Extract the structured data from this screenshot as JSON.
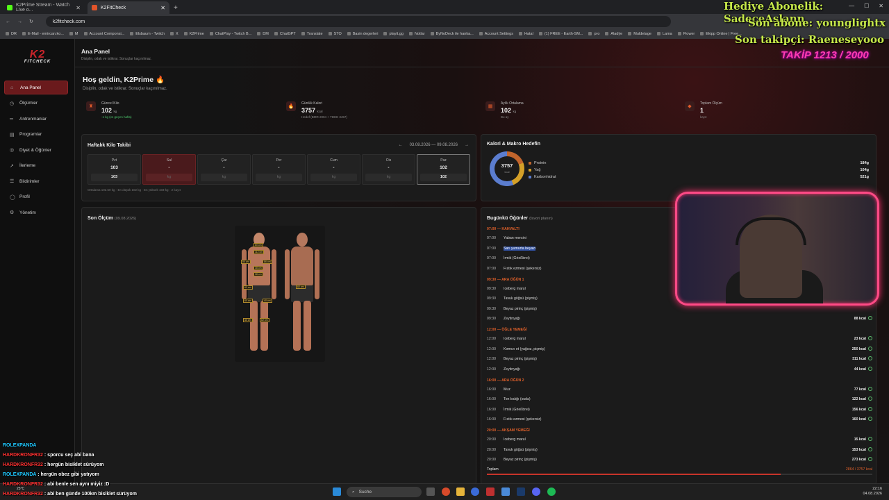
{
  "browser": {
    "tabs": [
      {
        "label": "K2Prime Stream - Watch Live o...",
        "active": false
      },
      {
        "label": "K2FitCheck",
        "active": true
      }
    ],
    "new_tab": "+",
    "url": "k2fitcheck.com",
    "bookmarks": [
      "DR",
      "E-Mail - emircan.ko...",
      "M",
      "Account Componsi...",
      "Elsbaum - Twitch",
      "X",
      "K2Prime",
      "ChatPlay - Twitch B...",
      "DM",
      "ChatGPT",
      "Translate",
      "STO",
      "Basin degerleri",
      "playit.gg",
      "Notlar",
      "ByNoDeck ile hanka...",
      "Account Settings",
      "Hatal",
      "(1) FREE - Earth-SM...",
      "pro",
      "Aladýe",
      "Muldetage",
      "Lama",
      "Flower",
      "Ekipp Online | Free..."
    ]
  },
  "sidebar": {
    "logo": "K2",
    "logo_sub": "FITCHECK",
    "items": [
      {
        "icon": "⌂",
        "label": "Ana Panel",
        "active": true
      },
      {
        "icon": "◷",
        "label": "Ölçümler"
      },
      {
        "icon": "═",
        "label": "Antrenmanlar"
      },
      {
        "icon": "▤",
        "label": "Programlar"
      },
      {
        "icon": "◎",
        "label": "Diyet & Öğünler"
      },
      {
        "icon": "↗",
        "label": "İlerleme"
      },
      {
        "icon": "☰",
        "label": "Bildirimler"
      },
      {
        "icon": "◯",
        "label": "Profil"
      },
      {
        "icon": "⚙",
        "label": "Yönetim"
      }
    ]
  },
  "header": {
    "title": "Ana Panel",
    "subtitle": "Disiplin, odak ve istikrar. Sonuçlar kaçınılmaz."
  },
  "welcome": {
    "title": "Hoş geldin, K2Prime 🔥",
    "subtitle": "Disiplin, odak ve istikrar. Sonuçlar kaçınılmaz."
  },
  "stats": [
    {
      "icon": "♜",
      "label": "Güncel Kilo",
      "value": "102",
      "unit": "kg",
      "note": "-1 kg (vs geçen hafta)",
      "positive": true
    },
    {
      "icon": "🔥",
      "label": "Günlük Kalori",
      "value": "3757",
      "unit": "kcal",
      "note": "Hedef (BMR 2004 + TDEE 3457)"
    },
    {
      "icon": "▦",
      "label": "Aylık Ortalama",
      "value": "102",
      "unit": "kg",
      "note": "Bu ay"
    },
    {
      "icon": "◆",
      "label": "Toplam Ölçüm",
      "value": "1",
      "unit": "",
      "note": "kayıt"
    }
  ],
  "weekly": {
    "title": "Haftalık Kilo Takibi",
    "range": "03.08.2026 — 09.08.2026",
    "prev": "←",
    "next": "→",
    "days": [
      {
        "name": "Pzt",
        "value": "103",
        "input": "103",
        "state": "filled"
      },
      {
        "name": "Sal",
        "value": "-",
        "input": "kg",
        "state": "today"
      },
      {
        "name": "Çar",
        "value": "-",
        "input": "kg"
      },
      {
        "name": "Per",
        "value": "-",
        "input": "kg"
      },
      {
        "name": "Cum",
        "value": "-",
        "input": "kg"
      },
      {
        "name": "Cts",
        "value": "-",
        "input": "kg"
      },
      {
        "name": "Paz",
        "value": "102",
        "input": "102",
        "state": "selected"
      }
    ],
    "note": "Ortalama 102.50 kg · En düşük 102 kg · En yüksek 103 kg · 2 kayıt"
  },
  "macros": {
    "title": "Kalori & Makro Hedefin",
    "kcal": "3757",
    "kcal_unit": "kcal",
    "items": [
      {
        "name": "Protein",
        "value": "184g",
        "color": "#c1652c"
      },
      {
        "name": "Yağ",
        "value": "104g",
        "color": "#d4a028"
      },
      {
        "name": "Karbonhidrat",
        "value": "521g",
        "color": "#5b7dcf"
      }
    ]
  },
  "measurement": {
    "title": "Son Ölçüm",
    "date": "(09.08.2026)",
    "tags": [
      "60 cm",
      "112 cm",
      "80 cm",
      "86 cm",
      "38 cm",
      "38 cm",
      "60 cm",
      "40 cm",
      "40 cm",
      "62 cm",
      "62 cm",
      "82 cm"
    ]
  },
  "meals": {
    "title": "Bugünkü Öğünler",
    "subtitle": "(favori planın)",
    "groups": [
      {
        "header": "07:00 — KAHVALTI",
        "items": [
          {
            "time": "07:00",
            "name": "Yaban mersini",
            "kcal": "",
            "selected": false
          },
          {
            "time": "07:00",
            "name": "Sarı yumurta beyazı",
            "kcal": "",
            "selected": true
          },
          {
            "time": "07:00",
            "name": "İrmik (Grießbrei)",
            "kcal": ""
          },
          {
            "time": "07:00",
            "name": "Fıstık ezmesi (şekersiz)",
            "kcal": ""
          }
        ]
      },
      {
        "header": "09:30 — ARA ÖĞÜN 1",
        "items": [
          {
            "time": "09:30",
            "name": "Iceberg marul",
            "kcal": ""
          },
          {
            "time": "09:30",
            "name": "Tavuk göğsü (pişmiş)",
            "kcal": ""
          },
          {
            "time": "09:30",
            "name": "Beyaz pirinç (pişmiş)",
            "kcal": ""
          },
          {
            "time": "09:30",
            "name": "Zeytinyağı",
            "kcal": "88 kcal"
          }
        ]
      },
      {
        "header": "12:00 — ÖĞLE YEMEĞİ",
        "items": [
          {
            "time": "12:00",
            "name": "Iceberg marul",
            "kcal": "23 kcal"
          },
          {
            "time": "12:00",
            "name": "Kırmızı et (yağsız, pişmiş)",
            "kcal": "250 kcal"
          },
          {
            "time": "12:00",
            "name": "Beyaz pirinç (pişmiş)",
            "kcal": "311 kcal"
          },
          {
            "time": "12:00",
            "name": "Zeytinyağı",
            "kcal": "44 kcal"
          }
        ]
      },
      {
        "header": "16:00 — ARA ÖĞÜN 2",
        "items": [
          {
            "time": "16:00",
            "name": "Muz",
            "kcal": "77 kcal"
          },
          {
            "time": "16:00",
            "name": "Ton balığı (suda)",
            "kcal": "122 kcal"
          },
          {
            "time": "16:00",
            "name": "İrmik (Grießbrei)",
            "kcal": "156 kcal"
          },
          {
            "time": "16:00",
            "name": "Fıstık ezmesi (şekersiz)",
            "kcal": "160 kcal"
          }
        ]
      },
      {
        "header": "20:00 — AKŞAM YEMEĞİ",
        "items": [
          {
            "time": "20:00",
            "name": "Iceberg marul",
            "kcal": "15 kcal"
          },
          {
            "time": "20:00",
            "name": "Tavuk göğsü (pişmiş)",
            "kcal": "153 kcal"
          },
          {
            "time": "20:00",
            "name": "Beyaz pirinç (pişmiş)",
            "kcal": "273 kcal"
          }
        ]
      }
    ],
    "total_label": "Toplam",
    "total_value": "2864 / 3757 kcal",
    "total_fraction": 0.762
  },
  "overlay": {
    "sub_gift": "Hediye Abonelik: SadeceAslann",
    "last_sub": "Son abone: younglightx",
    "last_follow": "Son takipçi: Raeneseyooo",
    "follow_goal": "TAKİP 1213 / 2000"
  },
  "chat": [
    {
      "name": "ROLEXPANDA",
      "msg": "",
      "red": false
    },
    {
      "name": "HARDKRONFR32",
      "msg": ": sporcu seç abi bana",
      "red": true
    },
    {
      "name": "HARDKRONFR32",
      "msg": ": hergün bisiklet sürüyom",
      "red": true
    },
    {
      "name": "ROLEXPANDA",
      "msg": ": hergün obez gibi yatıyom",
      "red": false
    },
    {
      "name": "HARDKRONFR32",
      "msg": ": abi benle sen aynı miyiz :D",
      "red": true
    },
    {
      "name": "HARDKRONFR32",
      "msg": ": abi ben günde 100km bisiklet sürüyom",
      "red": true
    }
  ],
  "taskbar": {
    "search": "Suche",
    "weather": "25°C",
    "time": "22:16",
    "date": "04.08.2026"
  }
}
